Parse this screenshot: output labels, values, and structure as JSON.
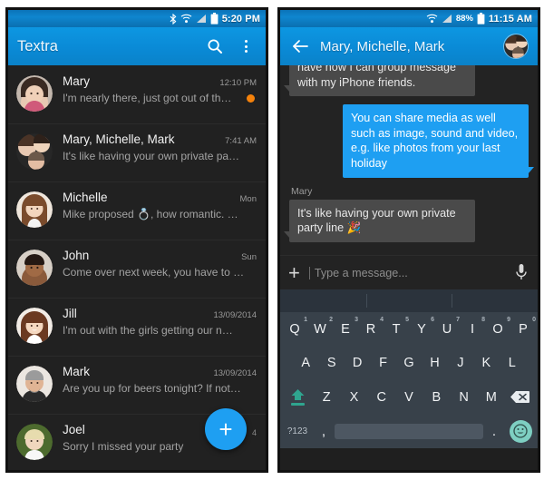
{
  "left_phone": {
    "status_bar": {
      "icons": [
        "bluetooth-icon",
        "wifi-icon",
        "signal-icon",
        "battery-icon"
      ],
      "time": "5:20 PM"
    },
    "app_bar": {
      "title": "Textra",
      "search_icon": "search-icon",
      "overflow_icon": "overflow-menu-icon"
    },
    "conversations": [
      {
        "name": "Mary",
        "time": "12:10 PM",
        "snippet": "I'm nearly there, just got out of th…",
        "unread": true,
        "avatar": "avatar-mary"
      },
      {
        "name": "Mary, Michelle, Mark",
        "time": "7:41 AM",
        "snippet": "It's like having your own private pa…",
        "unread": false,
        "avatar": "avatar-group"
      },
      {
        "name": "Michelle",
        "time": "Mon",
        "snippet": "Mike proposed 💍, how romantic. …",
        "unread": false,
        "avatar": "avatar-michelle"
      },
      {
        "name": "John",
        "time": "Sun",
        "snippet": "Come over next week, you have to …",
        "unread": false,
        "avatar": "avatar-john"
      },
      {
        "name": "Jill",
        "time": "13/09/2014",
        "snippet": "I'm out with the girls getting our n…",
        "unread": false,
        "avatar": "avatar-jill"
      },
      {
        "name": "Mark",
        "time": "13/09/2014",
        "snippet": "Are you up for beers tonight? If not…",
        "unread": false,
        "avatar": "avatar-mark"
      },
      {
        "name": "Joel",
        "time": "",
        "snippet": "Sorry I missed your party",
        "unread": false,
        "avatar": "avatar-joel"
      }
    ],
    "fab": {
      "label": "+",
      "badge": "4"
    }
  },
  "right_phone": {
    "status_bar": {
      "icons": [
        "wifi-icon",
        "signal-icon",
        "battery-icon"
      ],
      "battery": "88%",
      "time": "11:15 AM"
    },
    "app_bar": {
      "back_icon": "back-arrow-icon",
      "title": "Mary, Michelle, Mark",
      "avatar": "avatar-group"
    },
    "messages": [
      {
        "direction": "in",
        "sender": "",
        "text": "have now I can group message with my iPhone friends.",
        "clipped": true
      },
      {
        "direction": "out",
        "sender": "",
        "text": "You can share media as well such as image, sound and video, e.g. like photos from your last holiday",
        "clipped": false
      },
      {
        "direction": "in",
        "sender": "Mary",
        "text": "It's like having your own private party line 🎉",
        "clipped": false
      }
    ],
    "composer": {
      "attach_icon": "plus-icon",
      "placeholder": "Type a message...",
      "value": "",
      "mic_icon": "microphone-icon"
    },
    "keyboard": {
      "suggestions": [
        "",
        "",
        ""
      ],
      "row1": [
        {
          "key": "Q",
          "num": "1"
        },
        {
          "key": "W",
          "num": "2"
        },
        {
          "key": "E",
          "num": "3"
        },
        {
          "key": "R",
          "num": "4"
        },
        {
          "key": "T",
          "num": "5"
        },
        {
          "key": "Y",
          "num": "6"
        },
        {
          "key": "U",
          "num": "7"
        },
        {
          "key": "I",
          "num": "8"
        },
        {
          "key": "O",
          "num": "9"
        },
        {
          "key": "P",
          "num": "0"
        }
      ],
      "row2": [
        "A",
        "S",
        "D",
        "F",
        "G",
        "H",
        "J",
        "K",
        "L"
      ],
      "row3": {
        "shift": "shift-key-icon",
        "keys": [
          "Z",
          "X",
          "C",
          "V",
          "B",
          "N",
          "M"
        ],
        "delete": "backspace-key-icon"
      },
      "row4": {
        "symbols": "?123",
        "comma": ",",
        "space": "",
        "period": ".",
        "emoji": "emoji-key-icon"
      }
    }
  },
  "colors": {
    "accent_blue": "#1e9ff2",
    "appbar_blue": "#0a8ad6",
    "statusbar_blue": "#0f86cf",
    "unread_orange": "#f5820b",
    "keyboard_bg": "#38414a",
    "key_teal": "#7ecfc2",
    "list_bg": "#212121",
    "thread_bg": "#232323"
  }
}
